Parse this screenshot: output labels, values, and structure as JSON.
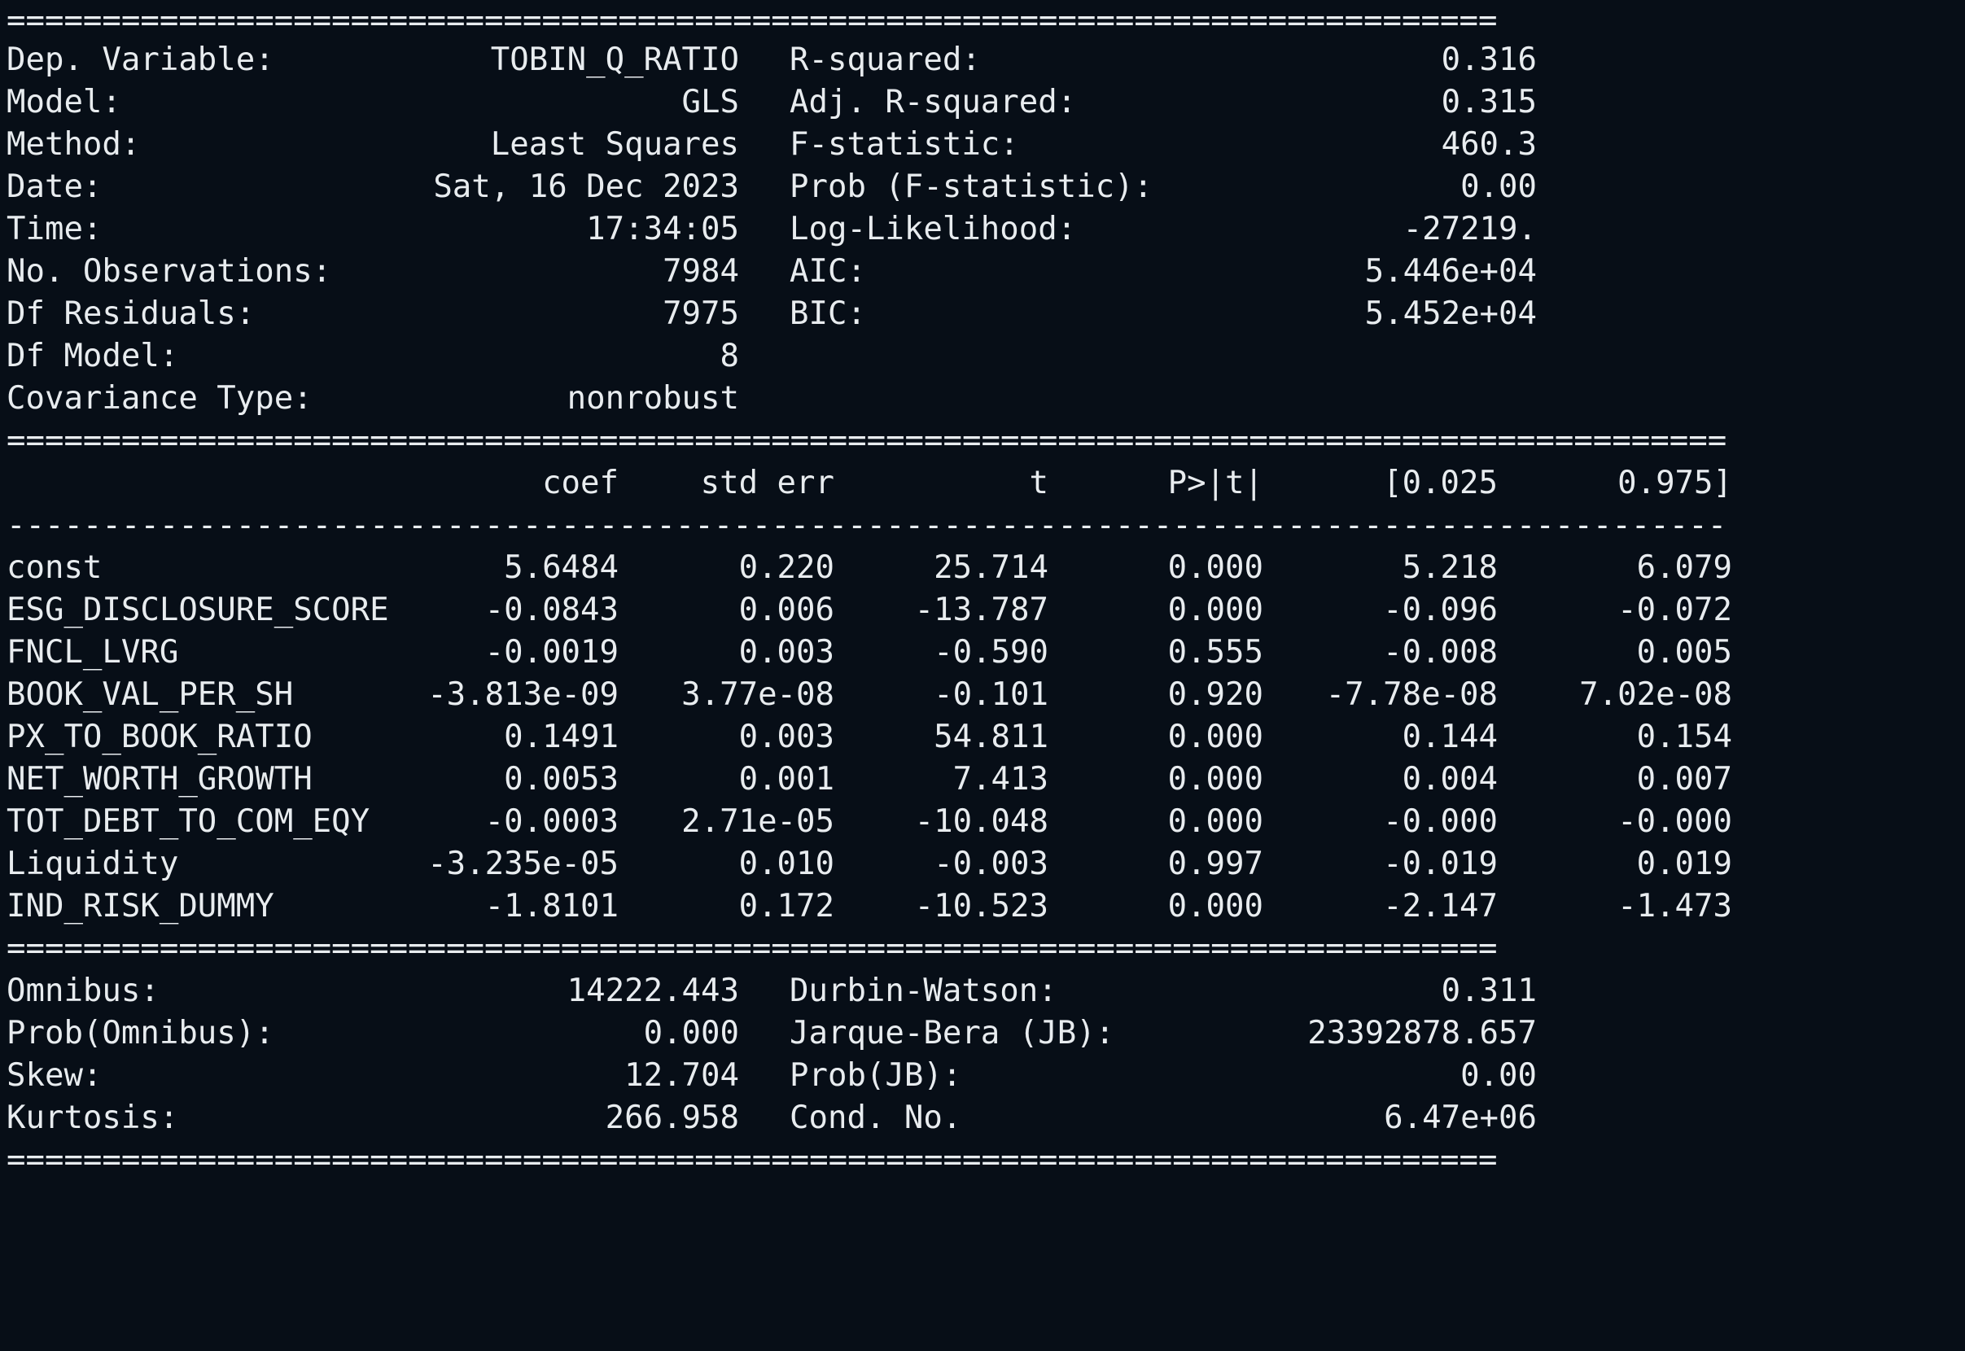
{
  "summary": {
    "left": [
      {
        "label": "Dep. Variable:",
        "value": "TOBIN_Q_RATIO"
      },
      {
        "label": "Model:",
        "value": "GLS"
      },
      {
        "label": "Method:",
        "value": "Least Squares"
      },
      {
        "label": "Date:",
        "value": "Sat, 16 Dec 2023"
      },
      {
        "label": "Time:",
        "value": "17:34:05"
      },
      {
        "label": "No. Observations:",
        "value": "7984"
      },
      {
        "label": "Df Residuals:",
        "value": "7975"
      },
      {
        "label": "Df Model:",
        "value": "8"
      },
      {
        "label": "Covariance Type:",
        "value": "nonrobust"
      }
    ],
    "right": [
      {
        "label": "R-squared:",
        "value": "0.316"
      },
      {
        "label": "Adj. R-squared:",
        "value": "0.315"
      },
      {
        "label": "F-statistic:",
        "value": "460.3"
      },
      {
        "label": "Prob (F-statistic):",
        "value": "0.00"
      },
      {
        "label": "Log-Likelihood:",
        "value": "-27219."
      },
      {
        "label": "AIC:",
        "value": "5.446e+04"
      },
      {
        "label": "BIC:",
        "value": "5.452e+04"
      }
    ]
  },
  "coef_table": {
    "headers": [
      "coef",
      "std err",
      "t",
      "P>|t|",
      "[0.025",
      "0.975]"
    ],
    "rows": [
      {
        "name": "const",
        "coef": "5.6484",
        "std_err": "0.220",
        "t": "25.714",
        "p": "0.000",
        "lo": "5.218",
        "hi": "6.079"
      },
      {
        "name": "ESG_DISCLOSURE_SCORE",
        "coef": "-0.0843",
        "std_err": "0.006",
        "t": "-13.787",
        "p": "0.000",
        "lo": "-0.096",
        "hi": "-0.072"
      },
      {
        "name": "FNCL_LVRG",
        "coef": "-0.0019",
        "std_err": "0.003",
        "t": "-0.590",
        "p": "0.555",
        "lo": "-0.008",
        "hi": "0.005"
      },
      {
        "name": "BOOK_VAL_PER_SH",
        "coef": "-3.813e-09",
        "std_err": "3.77e-08",
        "t": "-0.101",
        "p": "0.920",
        "lo": "-7.78e-08",
        "hi": "7.02e-08"
      },
      {
        "name": "PX_TO_BOOK_RATIO",
        "coef": "0.1491",
        "std_err": "0.003",
        "t": "54.811",
        "p": "0.000",
        "lo": "0.144",
        "hi": "0.154"
      },
      {
        "name": "NET_WORTH_GROWTH",
        "coef": "0.0053",
        "std_err": "0.001",
        "t": "7.413",
        "p": "0.000",
        "lo": "0.004",
        "hi": "0.007"
      },
      {
        "name": "TOT_DEBT_TO_COM_EQY",
        "coef": "-0.0003",
        "std_err": "2.71e-05",
        "t": "-10.048",
        "p": "0.000",
        "lo": "-0.000",
        "hi": "-0.000"
      },
      {
        "name": "Liquidity",
        "coef": "-3.235e-05",
        "std_err": "0.010",
        "t": "-0.003",
        "p": "0.997",
        "lo": "-0.019",
        "hi": "0.019"
      },
      {
        "name": "IND_RISK_DUMMY",
        "coef": "-1.8101",
        "std_err": "0.172",
        "t": "-10.523",
        "p": "0.000",
        "lo": "-2.147",
        "hi": "-1.473"
      }
    ]
  },
  "diagnostics": {
    "left": [
      {
        "label": "Omnibus:",
        "value": "14222.443"
      },
      {
        "label": "Prob(Omnibus):",
        "value": "0.000"
      },
      {
        "label": "Skew:",
        "value": "12.704"
      },
      {
        "label": "Kurtosis:",
        "value": "266.958"
      }
    ],
    "right": [
      {
        "label": "Durbin-Watson:",
        "value": "0.311"
      },
      {
        "label": "Jarque-Bera (JB):",
        "value": "23392878.657"
      },
      {
        "label": "Prob(JB):",
        "value": "0.00"
      },
      {
        "label": "Cond. No.",
        "value": "6.47e+06"
      }
    ]
  },
  "rules": {
    "double_short": "==============================================================================",
    "double_long": "==========================================================================================",
    "single_long": "------------------------------------------------------------------------------------------"
  }
}
